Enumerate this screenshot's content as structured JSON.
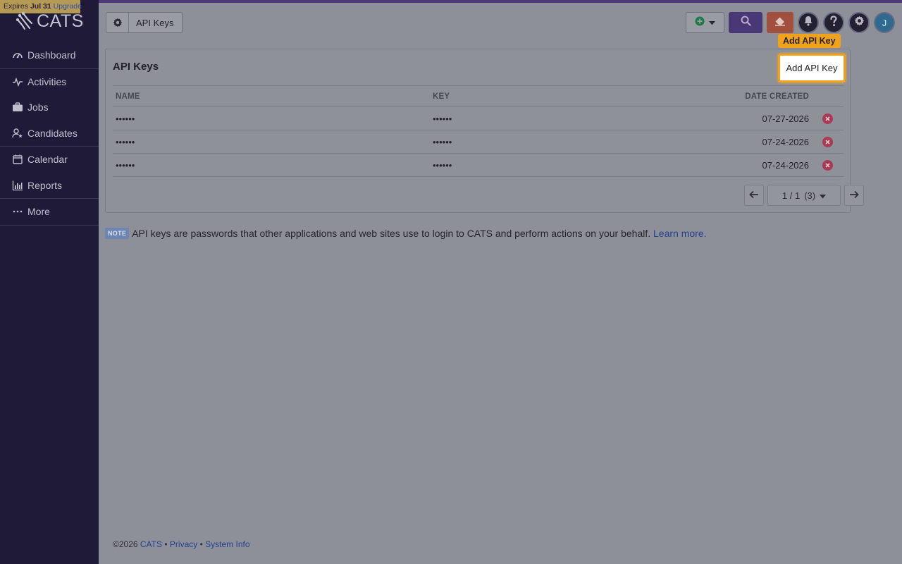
{
  "brand": {
    "name": "CATS"
  },
  "trial": {
    "prefix": "Expires ",
    "date": "Jul 31",
    "upgrade": "Upgrade"
  },
  "sidebar": {
    "items": [
      {
        "label": "Dashboard",
        "icon": "dashboard-icon"
      },
      {
        "label": "Activities",
        "icon": "activity-icon"
      },
      {
        "label": "Jobs",
        "icon": "briefcase-icon"
      },
      {
        "label": "Candidates",
        "icon": "candidates-icon"
      },
      {
        "label": "Calendar",
        "icon": "calendar-icon"
      },
      {
        "label": "Reports",
        "icon": "reports-icon"
      },
      {
        "label": "More",
        "icon": "more-icon"
      }
    ]
  },
  "header": {
    "breadcrumb": "API Keys",
    "user_initial": "J"
  },
  "tooltip": "Add API Key",
  "card": {
    "title": "API Keys",
    "add_button": "Add API Key",
    "columns": {
      "name": "NAME",
      "key": "KEY",
      "date": "DATE CREATED"
    },
    "rows": [
      {
        "name": "••••••",
        "key": "••••••",
        "date": "07-27-2026"
      },
      {
        "name": "••••••",
        "key": "••••••",
        "date": "07-24-2026"
      },
      {
        "name": "••••••",
        "key": "••••••",
        "date": "07-24-2026"
      }
    ],
    "pager": {
      "label": "1 / 1",
      "count": "(3)"
    }
  },
  "note": {
    "badge": "NOTE",
    "text": "API keys are passwords that other applications and web sites use to login to CATS and perform actions on your behalf.",
    "link": "Learn more."
  },
  "footer": {
    "copyright": "©2026",
    "cats": "CATS",
    "privacy": "Privacy",
    "system_info": "System Info",
    "sep": "•"
  },
  "colors": {
    "sidebar": "#1f1a38",
    "accent": "#4a3876",
    "highlight": "#f0a21a",
    "danger": "#a83a55"
  }
}
